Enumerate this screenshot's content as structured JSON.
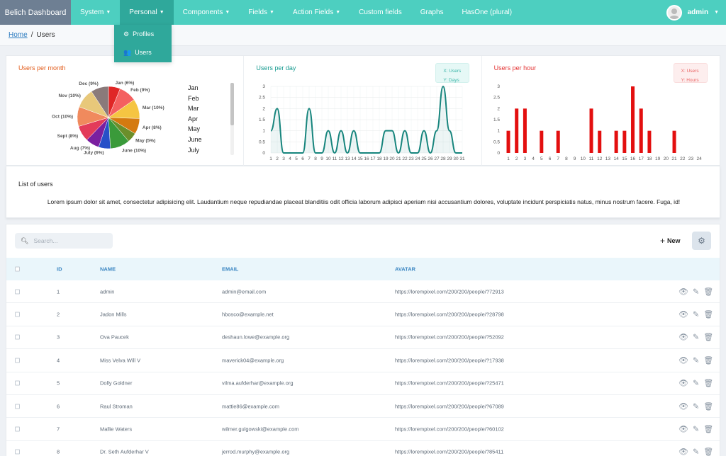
{
  "nav": {
    "brand": "Belich Dashboard",
    "items": [
      {
        "label": "System",
        "caret": true
      },
      {
        "label": "Personal",
        "caret": true
      },
      {
        "label": "Components",
        "caret": true
      },
      {
        "label": "Fields",
        "caret": true
      },
      {
        "label": "Action Fields",
        "caret": true
      },
      {
        "label": "Custom fields",
        "caret": false
      },
      {
        "label": "Graphs",
        "caret": false
      },
      {
        "label": "HasOne (plural)",
        "caret": false
      }
    ],
    "active_index": 1,
    "user": "admin"
  },
  "dropdown": {
    "items": [
      {
        "label": "Profiles",
        "icon": "cogs-icon"
      },
      {
        "label": "Users",
        "icon": "users-icon"
      }
    ]
  },
  "breadcrumb": {
    "home": "Home",
    "separator": "/",
    "current": "Users"
  },
  "colors": {
    "nav": "#4dcfc0",
    "nav_active": "#2fa89b",
    "line": "#17857d",
    "bars": "#e30f0f",
    "title_orange": "#e25c1b",
    "title_teal": "#159a8f",
    "title_red": "#e33434"
  },
  "charts": {
    "month": {
      "title": "Users per month",
      "list": [
        "Jan",
        "Feb",
        "Mar",
        "Apr",
        "May",
        "June",
        "July"
      ]
    },
    "day": {
      "title": "Users per day",
      "legend_x": "X:  Users",
      "legend_y": "Y:  Days"
    },
    "hour": {
      "title": "Users per hour",
      "legend_x": "X:  Users",
      "legend_y": "Y:  Hours"
    }
  },
  "chart_data": [
    {
      "type": "pie",
      "title": "Users per month",
      "labels": [
        "Jan (6%)",
        "Feb (9%)",
        "Mar (10%)",
        "Apr (8%)",
        "May (5%)",
        "June (10%)",
        "July (6%)",
        "Aug (7%)",
        "Sept (8%)",
        "Oct (10%)",
        "Nov (10%)",
        "Dec (9%)"
      ],
      "values": [
        6,
        9,
        10,
        8,
        5,
        10,
        6,
        7,
        8,
        10,
        10,
        9
      ],
      "colors": [
        "#e02626",
        "#f46060",
        "#f5c542",
        "#d47a10",
        "#6b8f2a",
        "#3a9a3a",
        "#2650c8",
        "#7a1fa0",
        "#e33b5a",
        "#f08a5d",
        "#e8c87a",
        "#8a7a7a"
      ]
    },
    {
      "type": "area",
      "title": "Users per day",
      "x": [
        1,
        2,
        3,
        4,
        5,
        6,
        7,
        8,
        9,
        10,
        11,
        12,
        13,
        14,
        15,
        16,
        17,
        18,
        19,
        20,
        21,
        22,
        23,
        24,
        25,
        26,
        27,
        28,
        29,
        30,
        31
      ],
      "values": [
        1,
        2,
        0,
        0,
        0,
        0,
        2,
        0,
        0,
        1,
        0,
        1,
        0,
        1,
        0,
        0,
        0,
        0,
        1,
        1,
        0,
        1,
        0,
        0,
        1,
        0,
        1,
        3,
        1,
        0,
        0
      ],
      "ylim": [
        0,
        3
      ],
      "yticks": [
        "0",
        "0.5",
        "1",
        "1.5",
        "2",
        "2.5",
        "3"
      ]
    },
    {
      "type": "bar",
      "title": "Users per hour",
      "categories": [
        "1",
        "2",
        "3",
        "4",
        "5",
        "6",
        "7",
        "8",
        "9",
        "10",
        "11",
        "12",
        "13",
        "14",
        "15",
        "16",
        "17",
        "18",
        "19",
        "20",
        "21",
        "22",
        "23",
        "24"
      ],
      "values": [
        1,
        2,
        2,
        0,
        1,
        0,
        1,
        0,
        0,
        0,
        2,
        1,
        0,
        1,
        1,
        3,
        2,
        1,
        0,
        0,
        1,
        0,
        0,
        0
      ],
      "ylim": [
        0,
        3
      ],
      "yticks": [
        "0",
        "0.5",
        "1",
        "1.5",
        "2",
        "2.5",
        "3"
      ]
    }
  ],
  "list": {
    "title": "List of users",
    "description": "Lorem ipsum dolor sit amet, consectetur adipisicing elit. Laudantium neque repudiandae placeat blanditiis odit officia laborum adipisci aperiam nisi accusantium dolores, voluptate incidunt perspiciatis natus, minus nostrum facere. Fuga, id!"
  },
  "table": {
    "search_placeholder": "Search...",
    "new_label": "New",
    "headers": {
      "id": "ID",
      "name": "NAME",
      "email": "EMAIL",
      "avatar": "AVATAR"
    },
    "rows": [
      {
        "id": "1",
        "name": "admin",
        "email": "admin@email.com",
        "avatar": "https://lorempixel.com/200/200/people/?72913"
      },
      {
        "id": "2",
        "name": "Jadon Mills",
        "email": "hbosco@example.net",
        "avatar": "https://lorempixel.com/200/200/people/?28798"
      },
      {
        "id": "3",
        "name": "Ova Paucek",
        "email": "deshaun.lowe@example.org",
        "avatar": "https://lorempixel.com/200/200/people/?52092"
      },
      {
        "id": "4",
        "name": "Miss Velva Will V",
        "email": "maverick04@example.org",
        "avatar": "https://lorempixel.com/200/200/people/?17938"
      },
      {
        "id": "5",
        "name": "Dolly Goldner",
        "email": "vilma.aufderhar@example.org",
        "avatar": "https://lorempixel.com/200/200/people/?25471"
      },
      {
        "id": "6",
        "name": "Raul Stroman",
        "email": "mattie86@example.com",
        "avatar": "https://lorempixel.com/200/200/people/?67089"
      },
      {
        "id": "7",
        "name": "Mallie Waters",
        "email": "wilmer.gulgowski@example.com",
        "avatar": "https://lorempixel.com/200/200/people/?60102"
      },
      {
        "id": "8",
        "name": "Dr. Seth Aufderhar V",
        "email": "jerrod.murphy@example.org",
        "avatar": "https://lorempixel.com/200/200/people/?85411"
      }
    ]
  }
}
